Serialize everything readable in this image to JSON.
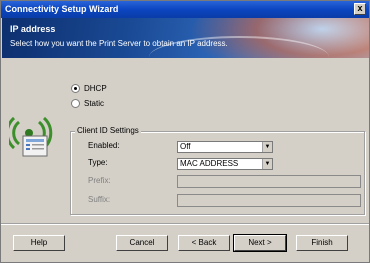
{
  "window": {
    "title": "Connectivity Setup Wizard",
    "close_glyph": "x"
  },
  "header": {
    "title": "IP address",
    "subtitle": "Select how you want the Print Server to obtain an IP address."
  },
  "ip_mode": {
    "options": [
      {
        "label": "DHCP",
        "checked": true
      },
      {
        "label": "Static",
        "checked": false
      }
    ]
  },
  "client_id": {
    "group_label": "Client ID Settings",
    "enabled": {
      "label": "Enabled:",
      "value": "Off"
    },
    "type": {
      "label": "Type:",
      "value": "MAC ADDRESS"
    },
    "prefix": {
      "label": "Prefix:",
      "value": ""
    },
    "suffix": {
      "label": "Suffix:",
      "value": ""
    }
  },
  "buttons": {
    "help": "Help",
    "cancel": "Cancel",
    "back": "< Back",
    "next": "Next >",
    "finish": "Finish"
  },
  "colors": {
    "titlebar": "#0b45c0",
    "header_dark": "#0d2f6e",
    "dialog_bg": "#d4d0c8",
    "icon_green": "#3c8f2a"
  },
  "icons": {
    "device": "network-print-server-icon"
  }
}
